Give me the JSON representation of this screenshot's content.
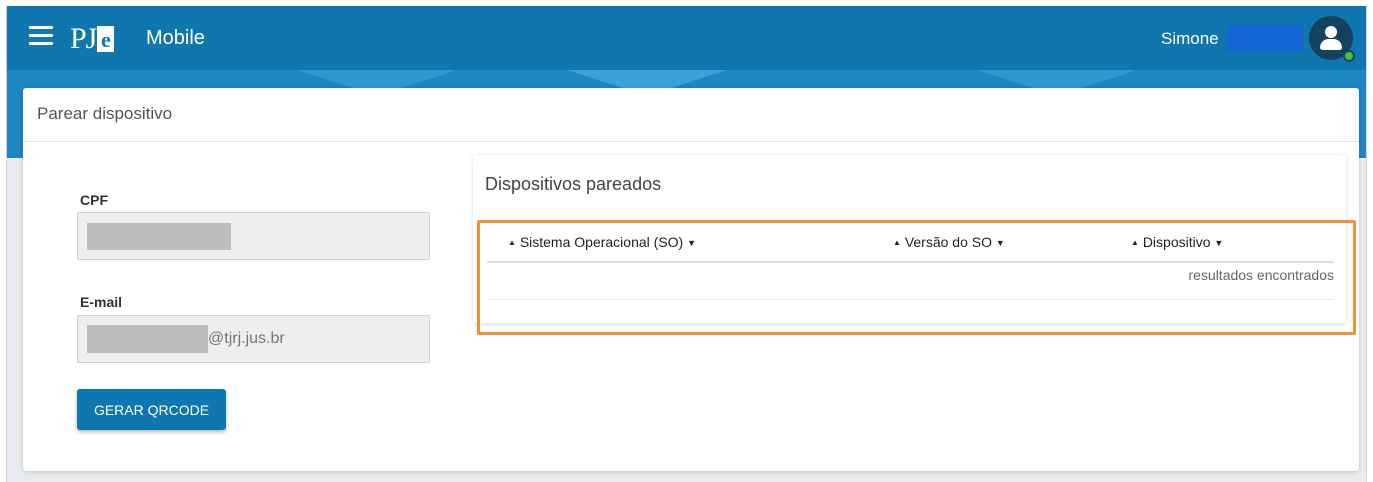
{
  "header": {
    "app_name": "Mobile",
    "logo_text": "PJe",
    "user_name": "Simone"
  },
  "card": {
    "title": "Parear dispositivo"
  },
  "form": {
    "cpf_label": "CPF",
    "cpf_value": "",
    "email_label": "E-mail",
    "email_suffix": "@tjrj.jus.br",
    "generate_button": "GERAR QRCODE"
  },
  "devices": {
    "title": "Dispositivos pareados",
    "columns": [
      "Sistema Operacional (SO)",
      "Versão do SO",
      "Dispositivo"
    ],
    "rows": [],
    "results_text": "resultados encontrados"
  },
  "colors": {
    "primary": "#0f77ad",
    "highlight": "#f29136",
    "status_online": "#44c33b"
  }
}
